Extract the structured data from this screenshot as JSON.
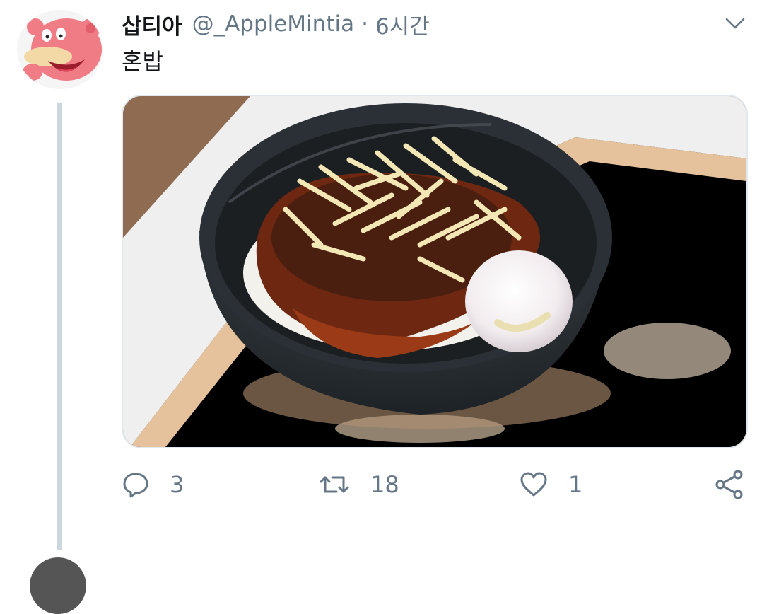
{
  "tweet": {
    "display_name": "삽티아",
    "handle": "@_AppleMintia",
    "separator": "·",
    "time": "6시간",
    "text": "혼밥",
    "media_icon": "photo-rice-bowl"
  },
  "actions": {
    "reply_count": "3",
    "retweet_count": "18",
    "like_count": "1"
  },
  "icons": {
    "reply": "speech-bubble-icon",
    "retweet": "retweet-icon",
    "like": "heart-icon",
    "share": "share-icon",
    "menu": "chevron-down-icon"
  },
  "colors": {
    "text": "#14171a",
    "secondary": "#657786",
    "thread_line": "#ccd6dd"
  }
}
